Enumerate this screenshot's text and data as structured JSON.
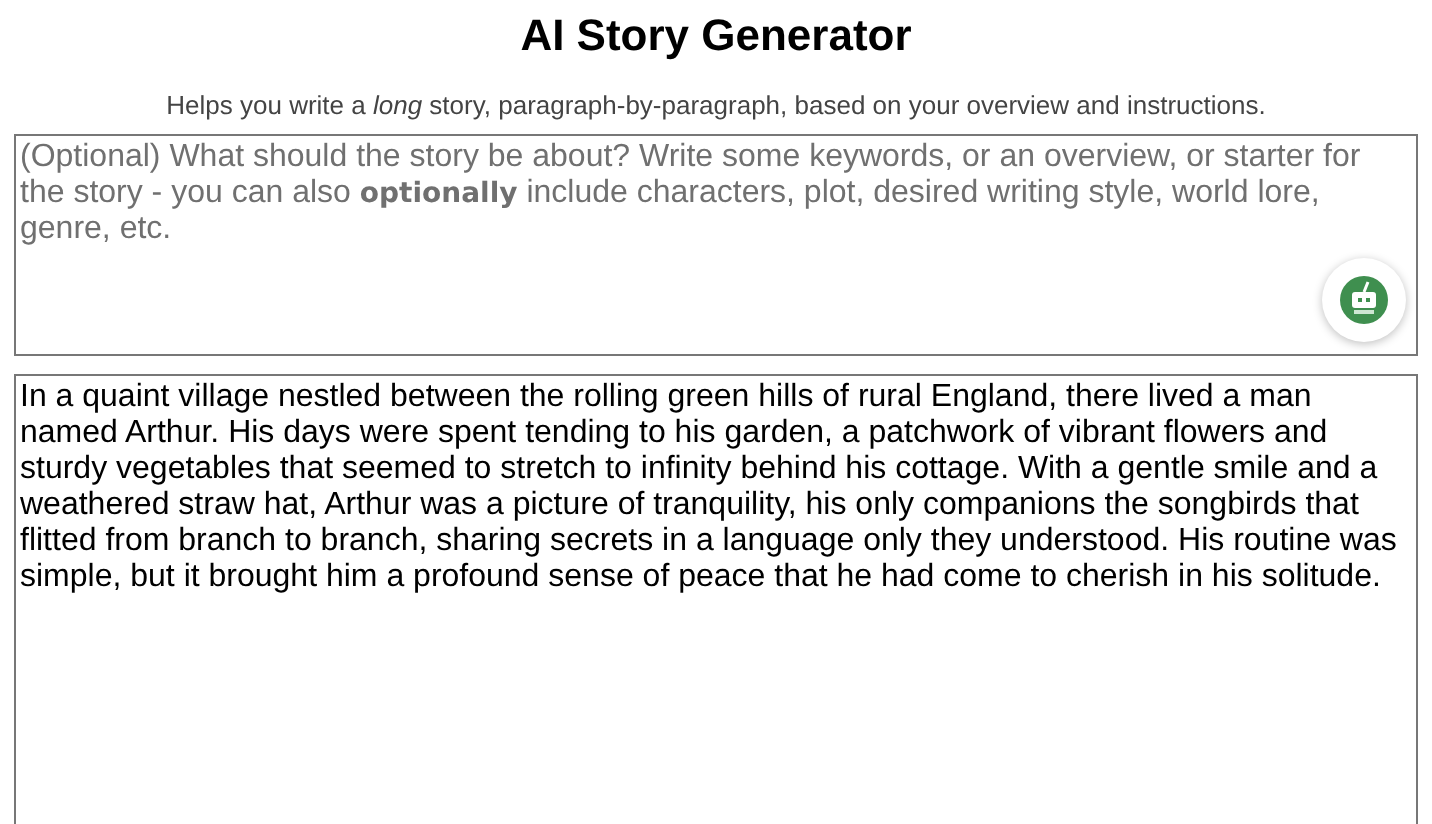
{
  "title": "AI Story Generator",
  "subtitle": "Helps you write a *long* story, paragraph-by-paragraph, based on your overview and instructions.",
  "overview_field": {
    "placeholder": "(Optional) What should the story be about? Write some keywords, or an overview, or starter for the story - you can also **optionally** include characters, plot, desired writing style, world lore, genre, etc."
  },
  "story_field": {
    "value": "In a quaint village nestled between the rolling green hills of rural England, there lived a man named Arthur. His days were spent tending to his garden, a patchwork of vibrant flowers and sturdy vegetables that seemed to stretch to infinity behind his cottage. With a gentle smile and a weathered straw hat, Arthur was a picture of tranquility, his only companions the songbirds that flitted from branch to branch, sharing secrets in a language only they understood. His routine was simple, but it brought him a profound sense of peace that he had come to cherish in his solitude."
  }
}
